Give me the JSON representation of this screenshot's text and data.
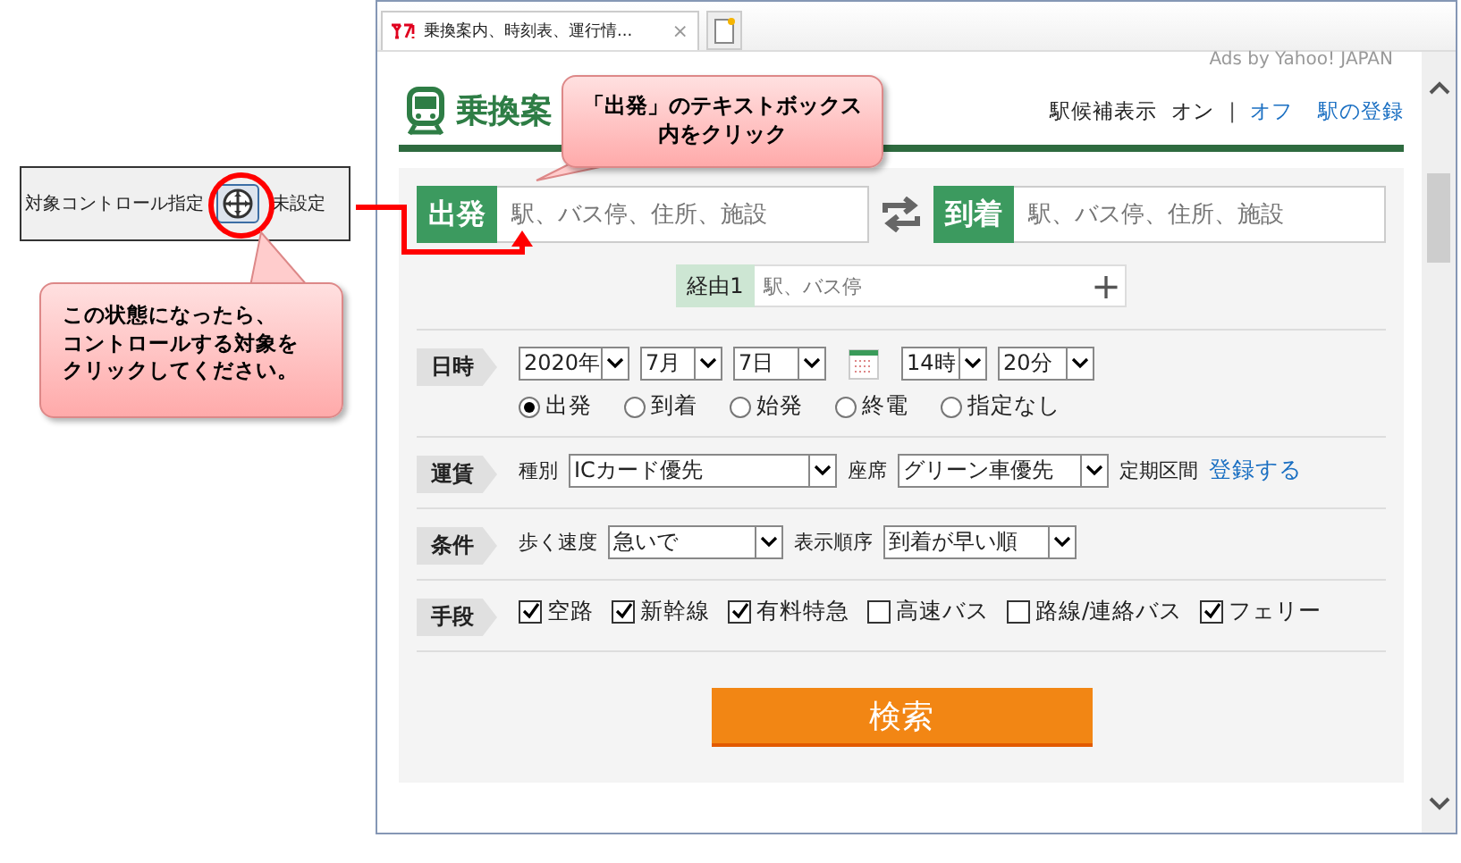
{
  "control_panel": {
    "label": "対象コントロール指定",
    "status": "未設定"
  },
  "callouts": [
    {
      "lines": [
        "「出発」のテキストボックス",
        "内をクリック"
      ]
    },
    {
      "lines": [
        "この状態になったら、",
        "コントロールする対象を",
        "クリックしてください。"
      ]
    }
  ],
  "browser": {
    "tab_title": "乗換案内、時刻表、運行情...",
    "tab_close": "×",
    "ads": "Ads by Yahoo! JAPAN"
  },
  "header": {
    "title": "乗換案",
    "suggest_label": "駅候補表示",
    "options": [
      {
        "label": "オン",
        "selected": true
      },
      {
        "label": "オフ",
        "selected": false
      }
    ],
    "separator": "|",
    "register_link": "駅の登録"
  },
  "route": {
    "from": {
      "label": "出発",
      "placeholder": "駅、バス停、住所、施設"
    },
    "to": {
      "label": "到着",
      "placeholder": "駅、バス停、住所、施設"
    },
    "via": {
      "label": "経由1",
      "placeholder": "駅、バス停",
      "add": "+"
    }
  },
  "sections": [
    {
      "kind": "datetime",
      "label": "日時",
      "selects": [
        {
          "value": "2020年"
        },
        {
          "value": "7月"
        },
        {
          "value": "7日"
        },
        {
          "value": "14時"
        },
        {
          "value": "20分"
        }
      ],
      "radios": [
        {
          "label": "出発",
          "selected": true
        },
        {
          "label": "到着",
          "selected": false
        },
        {
          "label": "始発",
          "selected": false
        },
        {
          "label": "終電",
          "selected": false
        },
        {
          "label": "指定なし",
          "selected": false
        }
      ]
    },
    {
      "kind": "fields",
      "label": "運賃",
      "fields": [
        {
          "label": "種別",
          "value": "ICカード優先"
        },
        {
          "label": "座席",
          "value": "グリーン車優先"
        }
      ],
      "extra_label": "定期区間",
      "extra_link": "登録する"
    },
    {
      "kind": "fields",
      "label": "条件",
      "fields": [
        {
          "label": "歩く速度",
          "value": "急いで"
        },
        {
          "label": "表示順序",
          "value": "到着が早い順"
        }
      ]
    },
    {
      "kind": "checks",
      "label": "手段",
      "checks": [
        {
          "label": "空路",
          "checked": true
        },
        {
          "label": "新幹線",
          "checked": true
        },
        {
          "label": "有料特急",
          "checked": true
        },
        {
          "label": "高速バス",
          "checked": false
        },
        {
          "label": "路線/連絡バス",
          "checked": false
        },
        {
          "label": "フェリー",
          "checked": true
        }
      ]
    }
  ],
  "search_button": "検索"
}
